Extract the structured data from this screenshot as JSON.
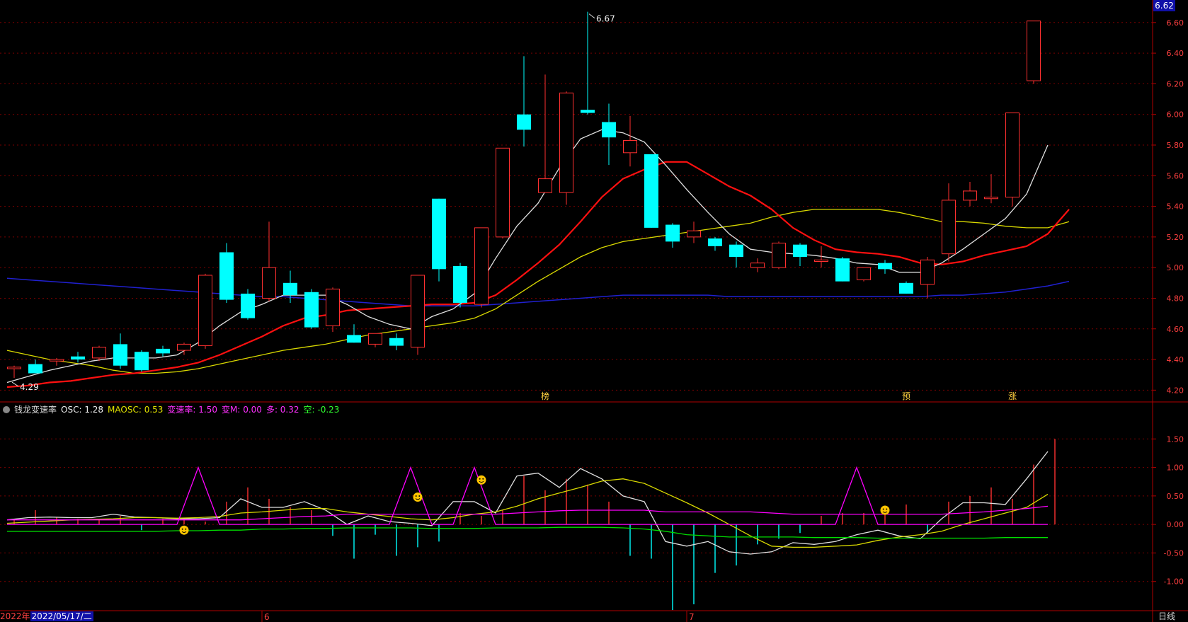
{
  "price_badge": "6.62",
  "indicator": {
    "name": "钱龙变速率",
    "osc": "OSC: 1.28",
    "maosc": "MAOSC: 0.53",
    "bsl": "变速率: 1.50",
    "bm": "变M: 0.00",
    "duo": "多: 0.32",
    "kong": "空: -0.23"
  },
  "bottom_bar": {
    "year": "2022年",
    "date": "2022/05/17/二",
    "period": "日线"
  },
  "colors": {
    "up": "#ff3030",
    "down": "#00ffff",
    "ma_white": "#e0e0e0",
    "ma_red": "#ff1010",
    "ma_yellow": "#d8d800",
    "ma_blue": "#2020d0",
    "grid": "#7a0000",
    "axis": "#b00000",
    "tick": "#ff4040"
  },
  "chart_data": [
    {
      "type": "candlestick",
      "y_ticks": [
        "6.60",
        "6.40",
        "6.20",
        "6.00",
        "5.80",
        "5.60",
        "5.40",
        "5.20",
        "5.00",
        "4.80",
        "4.60",
        "4.40",
        "4.20"
      ],
      "ylim": [
        4.16,
        6.71
      ],
      "max_label": "6.67",
      "min_label": "4.29",
      "candles": [
        [
          4.34,
          4.36,
          4.28,
          4.35
        ],
        [
          4.37,
          4.4,
          4.33,
          4.31
        ],
        [
          4.39,
          4.41,
          4.36,
          4.4
        ],
        [
          4.42,
          4.45,
          4.38,
          4.4
        ],
        [
          4.41,
          4.49,
          4.39,
          4.48
        ],
        [
          4.5,
          4.57,
          4.34,
          4.36
        ],
        [
          4.45,
          4.46,
          4.32,
          4.33
        ],
        [
          4.47,
          4.49,
          4.42,
          4.44
        ],
        [
          4.46,
          4.51,
          4.43,
          4.5
        ],
        [
          4.49,
          4.96,
          4.47,
          4.95
        ],
        [
          5.1,
          5.16,
          4.77,
          4.79
        ],
        [
          4.83,
          4.86,
          4.66,
          4.67
        ],
        [
          4.8,
          5.3,
          4.78,
          5.0
        ],
        [
          4.9,
          4.98,
          4.77,
          4.82
        ],
        [
          4.84,
          4.86,
          4.6,
          4.61
        ],
        [
          4.62,
          4.87,
          4.58,
          4.86
        ],
        [
          4.56,
          4.63,
          4.51,
          4.51
        ],
        [
          4.5,
          4.57,
          4.48,
          4.57
        ],
        [
          4.54,
          4.57,
          4.46,
          4.49
        ],
        [
          4.48,
          4.95,
          4.43,
          4.95
        ],
        [
          5.45,
          5.45,
          4.91,
          4.99
        ],
        [
          5.01,
          5.03,
          4.74,
          4.77
        ],
        [
          4.76,
          5.26,
          4.74,
          5.26
        ],
        [
          5.2,
          5.78,
          5.19,
          5.78
        ],
        [
          6.0,
          6.38,
          5.79,
          5.9
        ],
        [
          5.49,
          6.26,
          5.49,
          5.58
        ],
        [
          5.49,
          6.15,
          5.41,
          6.14
        ],
        [
          6.03,
          6.67,
          6.0,
          6.01
        ],
        [
          5.95,
          6.07,
          5.67,
          5.85
        ],
        [
          5.75,
          5.99,
          5.66,
          5.83
        ],
        [
          5.74,
          5.74,
          5.26,
          5.26
        ],
        [
          5.28,
          5.29,
          5.13,
          5.17
        ],
        [
          5.2,
          5.3,
          5.16,
          5.24
        ],
        [
          5.19,
          5.2,
          5.11,
          5.14
        ],
        [
          5.15,
          5.17,
          5.0,
          5.07
        ],
        [
          5.0,
          5.06,
          4.97,
          5.03
        ],
        [
          5.0,
          5.17,
          4.99,
          5.16
        ],
        [
          5.15,
          5.16,
          5.01,
          5.07
        ],
        [
          5.04,
          5.14,
          5.0,
          5.05
        ],
        [
          5.06,
          5.07,
          4.91,
          4.91
        ],
        [
          4.92,
          5.0,
          4.91,
          5.0
        ],
        [
          5.03,
          5.05,
          4.96,
          4.99
        ],
        [
          4.9,
          4.91,
          4.83,
          4.83
        ],
        [
          4.89,
          5.07,
          4.8,
          5.05
        ],
        [
          5.09,
          5.55,
          5.04,
          5.44
        ],
        [
          5.44,
          5.56,
          5.4,
          5.5
        ],
        [
          5.45,
          5.61,
          5.42,
          5.46
        ],
        [
          5.46,
          6.01,
          5.4,
          6.01
        ],
        [
          6.22,
          6.61,
          6.2,
          6.61
        ]
      ],
      "ma_white": [
        4.25,
        4.29,
        4.33,
        4.36,
        4.39,
        4.41,
        4.41,
        4.41,
        4.43,
        4.51,
        4.62,
        4.71,
        4.76,
        4.82,
        4.82,
        4.82,
        4.76,
        4.68,
        4.63,
        4.6,
        4.68,
        4.73,
        4.83,
        5.06,
        5.27,
        5.42,
        5.65,
        5.84,
        5.9,
        5.88,
        5.82,
        5.67,
        5.51,
        5.36,
        5.22,
        5.12,
        5.1,
        5.09,
        5.08,
        5.06,
        5.03,
        5.02,
        4.97,
        4.97,
        5.03,
        5.12,
        5.22,
        5.32,
        5.48,
        5.8
      ],
      "ma_red": [
        4.22,
        4.23,
        4.25,
        4.26,
        4.28,
        4.3,
        4.31,
        4.33,
        4.35,
        4.38,
        4.43,
        4.49,
        4.55,
        4.62,
        4.67,
        4.69,
        4.72,
        4.73,
        4.74,
        4.75,
        4.76,
        4.76,
        4.77,
        4.82,
        4.92,
        5.03,
        5.15,
        5.3,
        5.46,
        5.58,
        5.64,
        5.69,
        5.69,
        5.61,
        5.53,
        5.47,
        5.38,
        5.26,
        5.18,
        5.12,
        5.1,
        5.09,
        5.07,
        5.03,
        5.02,
        5.04,
        5.08,
        5.11,
        5.14,
        5.22,
        5.38
      ],
      "ma_yellow": [
        4.46,
        4.43,
        4.4,
        4.38,
        4.36,
        4.33,
        4.31,
        4.31,
        4.32,
        4.34,
        4.37,
        4.4,
        4.43,
        4.46,
        4.48,
        4.5,
        4.53,
        4.56,
        4.58,
        4.6,
        4.62,
        4.64,
        4.67,
        4.73,
        4.82,
        4.91,
        4.99,
        5.07,
        5.13,
        5.17,
        5.19,
        5.21,
        5.23,
        5.25,
        5.27,
        5.29,
        5.33,
        5.36,
        5.38,
        5.38,
        5.38,
        5.38,
        5.36,
        5.33,
        5.3,
        5.3,
        5.29,
        5.27,
        5.26,
        5.26,
        5.3
      ],
      "ma_blue": [
        4.93,
        4.92,
        4.91,
        4.9,
        4.89,
        4.88,
        4.87,
        4.86,
        4.85,
        4.84,
        4.83,
        4.82,
        4.81,
        4.81,
        4.8,
        4.79,
        4.78,
        4.77,
        4.76,
        4.75,
        4.75,
        4.75,
        4.75,
        4.76,
        4.77,
        4.78,
        4.79,
        4.8,
        4.81,
        4.82,
        4.82,
        4.82,
        4.82,
        4.82,
        4.81,
        4.81,
        4.81,
        4.81,
        4.81,
        4.81,
        4.81,
        4.81,
        4.81,
        4.81,
        4.82,
        4.82,
        4.83,
        4.84,
        4.86,
        4.88,
        4.91
      ],
      "markers": [
        {
          "index": 25,
          "label": "榜"
        },
        {
          "index": 42,
          "label": "预"
        },
        {
          "index": 47,
          "label": "涨"
        }
      ]
    },
    {
      "type": "line",
      "title": "钱龙变速率",
      "y_ticks": [
        "1.50",
        "1.00",
        "0.50",
        "0.00",
        "-0.50",
        "-1.00"
      ],
      "ylim": [
        -1.5,
        2.0
      ],
      "series": [
        {
          "name": "OSC",
          "color": "#e0e0e0",
          "values": [
            0.08,
            0.12,
            0.13,
            0.12,
            0.12,
            0.18,
            0.13,
            0.12,
            0.1,
            0.1,
            0.12,
            0.45,
            0.3,
            0.3,
            0.4,
            0.25,
            0.0,
            0.15,
            0.05,
            0.02,
            -0.02,
            0.4,
            0.4,
            0.2,
            0.85,
            0.9,
            0.65,
            0.98,
            0.8,
            0.5,
            0.4,
            -0.3,
            -0.38,
            -0.3,
            -0.48,
            -0.52,
            -0.48,
            -0.32,
            -0.35,
            -0.3,
            -0.18,
            -0.1,
            -0.2,
            -0.25,
            0.1,
            0.38,
            0.38,
            0.35,
            0.8,
            1.28
          ]
        },
        {
          "name": "MAOSC",
          "color": "#d8d800",
          "values": [
            0.02,
            0.04,
            0.06,
            0.08,
            0.09,
            0.1,
            0.12,
            0.12,
            0.11,
            0.12,
            0.14,
            0.2,
            0.22,
            0.25,
            0.28,
            0.28,
            0.22,
            0.18,
            0.14,
            0.1,
            0.08,
            0.12,
            0.18,
            0.22,
            0.32,
            0.45,
            0.55,
            0.65,
            0.76,
            0.8,
            0.72,
            0.55,
            0.38,
            0.2,
            0.0,
            -0.2,
            -0.38,
            -0.4,
            -0.4,
            -0.38,
            -0.36,
            -0.28,
            -0.22,
            -0.18,
            -0.12,
            0.0,
            0.1,
            0.2,
            0.3,
            0.53
          ]
        },
        {
          "name": "变M",
          "color": "#ff00ff",
          "values": [
            0.08,
            0.08,
            0.08,
            0.08,
            0.08,
            0.08,
            0.08,
            0.08,
            0.08,
            0.08,
            0.08,
            0.08,
            0.1,
            0.12,
            0.14,
            0.15,
            0.18,
            0.18,
            0.18,
            0.18,
            0.18,
            0.18,
            0.18,
            0.18,
            0.2,
            0.22,
            0.24,
            0.25,
            0.25,
            0.25,
            0.25,
            0.22,
            0.22,
            0.22,
            0.22,
            0.22,
            0.2,
            0.18,
            0.18,
            0.18,
            0.18,
            0.18,
            0.18,
            0.18,
            0.18,
            0.2,
            0.22,
            0.25,
            0.28,
            0.32
          ]
        },
        {
          "name": "空",
          "color": "#00dd00",
          "values": [
            -0.12,
            -0.12,
            -0.12,
            -0.12,
            -0.12,
            -0.12,
            -0.12,
            -0.12,
            -0.11,
            -0.11,
            -0.1,
            -0.1,
            -0.08,
            -0.08,
            -0.07,
            -0.07,
            -0.06,
            -0.06,
            -0.06,
            -0.06,
            -0.07,
            -0.07,
            -0.07,
            -0.06,
            -0.06,
            -0.06,
            -0.05,
            -0.05,
            -0.05,
            -0.06,
            -0.08,
            -0.12,
            -0.18,
            -0.2,
            -0.22,
            -0.22,
            -0.22,
            -0.22,
            -0.23,
            -0.23,
            -0.23,
            -0.24,
            -0.24,
            -0.24,
            -0.24,
            -0.24,
            -0.24,
            -0.23,
            -0.23,
            -0.23
          ]
        }
      ],
      "peak_series": {
        "name": "变速率",
        "color": "#ff00ff",
        "values": [
          0,
          0,
          0,
          0,
          0,
          0,
          0,
          0,
          0,
          1.0,
          0,
          0,
          0,
          0,
          0,
          0,
          0,
          0,
          0,
          1.0,
          0,
          0,
          1.0,
          0,
          0,
          0,
          0,
          0,
          0,
          0,
          0,
          0,
          0,
          0,
          0,
          0,
          0,
          0,
          0,
          0,
          1.0,
          0,
          0,
          0,
          0,
          0,
          0,
          0,
          0,
          0
        ]
      },
      "bars": [
        0.1,
        0.25,
        0.12,
        0.1,
        0.08,
        0.15,
        -0.1,
        0.1,
        0.12,
        0.05,
        0.4,
        0.65,
        0.45,
        0.3,
        0.25,
        -0.2,
        -0.6,
        -0.18,
        -0.55,
        -0.4,
        -0.3,
        0.2,
        0.15,
        0.25,
        0.85,
        0.6,
        0.8,
        0.7,
        0.4,
        -0.55,
        -0.6,
        -1.5,
        -1.4,
        -0.85,
        -0.72,
        -0.35,
        -0.25,
        -0.15,
        0.15,
        0.2,
        0.2,
        0.25,
        0.35,
        -0.15,
        0.4,
        0.5,
        0.65,
        0.45,
        1.05,
        1.5
      ],
      "faces": [
        {
          "index": 8,
          "value": -0.1
        },
        {
          "index": 19,
          "value": 0.48
        },
        {
          "index": 22,
          "value": 0.78
        },
        {
          "index": 41,
          "value": 0.25
        }
      ]
    }
  ],
  "x_labels": [
    "6",
    "7"
  ]
}
